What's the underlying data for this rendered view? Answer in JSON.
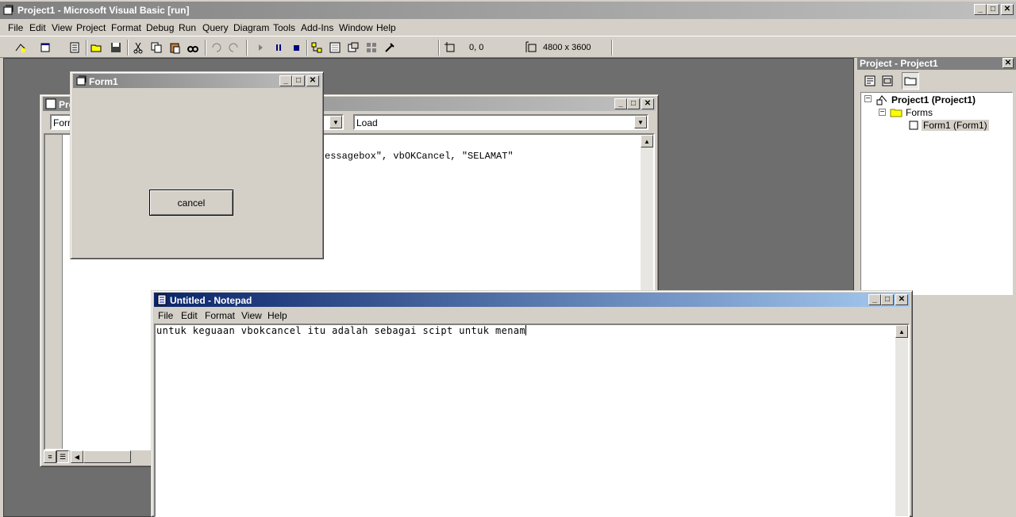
{
  "vb": {
    "title": "Project1 - Microsoft Visual Basic [run]",
    "menu": [
      "File",
      "Edit",
      "View",
      "Project",
      "Format",
      "Debug",
      "Run",
      "Query",
      "Diagram",
      "Tools",
      "Add-Ins",
      "Window",
      "Help"
    ],
    "toolbar": {
      "position": "0, 0",
      "size": "4800 x 3600"
    }
  },
  "project_explorer": {
    "title": "Project - Project1",
    "tree": {
      "project": "Project1 (Project1)",
      "folder": "Forms",
      "form": "Form1 (Form1)"
    }
  },
  "code_window": {
    "title": "Pro",
    "object_combo": "Forr",
    "proc_combo": "Load",
    "code_line": "essagebox\", vbOKCancel, \"SELAMAT\""
  },
  "form1": {
    "title": "Form1",
    "button_label": "cancel"
  },
  "notepad": {
    "title": "Untitled - Notepad",
    "menu": [
      "File",
      "Edit",
      "Format",
      "View",
      "Help"
    ],
    "text": "untuk keguaan vbokcancel itu adalah sebagai scipt untuk menam"
  }
}
